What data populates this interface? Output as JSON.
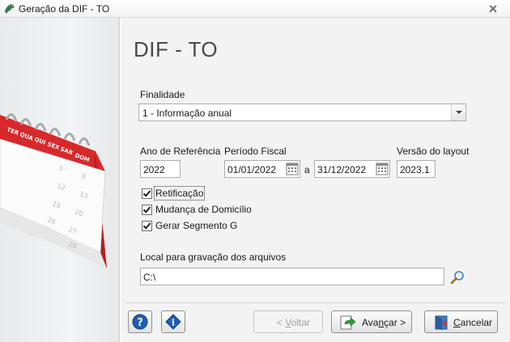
{
  "window": {
    "title": "Geração da DIF - TO"
  },
  "page": {
    "heading": "DIF - TO"
  },
  "calendar": {
    "days": [
      "TER",
      "QUA",
      "QUI",
      "SEX",
      "SAB",
      "DOM"
    ],
    "numbers": [
      "5",
      "6",
      "12",
      "13",
      "19",
      "20",
      "26",
      "27",
      "28"
    ]
  },
  "form": {
    "finalidade_label": "Finalidade",
    "finalidade_value": "1 - Informação anual",
    "ano_label": "Ano de Referência",
    "ano_value": "2022",
    "periodo_label": "Período Fiscal",
    "periodo_inicio": "01/01/2022",
    "periodo_sep": "a",
    "periodo_fim": "31/12/2022",
    "versao_label": "Versão do layout",
    "versao_value": "2023.1",
    "checkboxes": [
      {
        "label": "Retificação",
        "checked": true
      },
      {
        "label": "Mudança de Domicílio",
        "checked": true
      },
      {
        "label": "Gerar Segmento G",
        "checked": true
      }
    ],
    "local_label": "Local para gravação dos arquivos",
    "local_value": "C:\\"
  },
  "buttons": {
    "voltar": {
      "prefix": "< ",
      "accel": "V",
      "rest": "oltar"
    },
    "avancar": {
      "pre": "Ava",
      "accel": "n",
      "post": "çar >"
    },
    "cancelar": {
      "accel": "C",
      "rest": "ancelar"
    }
  },
  "colors": {
    "accent_red": "#d8282b",
    "help_blue": "#1f5fb0"
  }
}
